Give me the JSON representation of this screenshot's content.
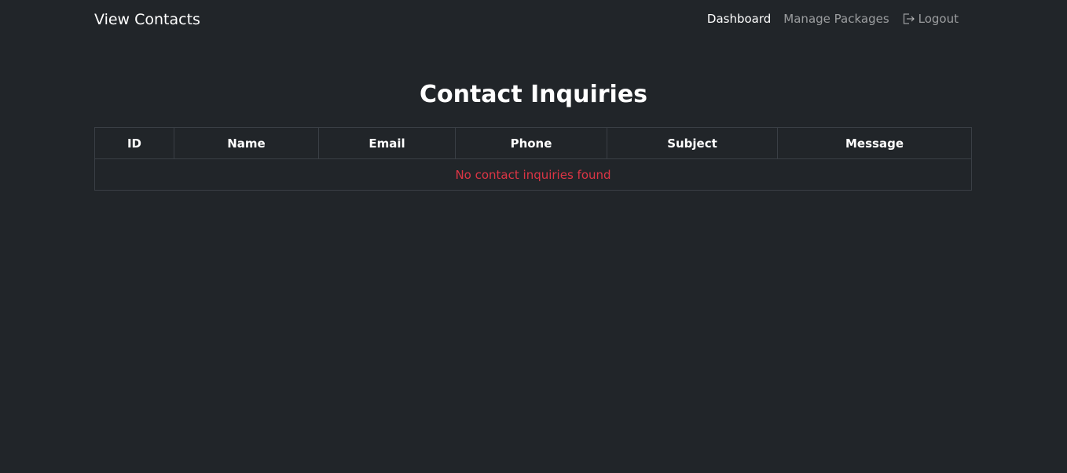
{
  "navbar": {
    "brand": "View Contacts",
    "links": [
      {
        "label": "Dashboard"
      },
      {
        "label": "Manage Packages"
      },
      {
        "label": "Logout",
        "icon": "logout-icon"
      }
    ]
  },
  "main": {
    "title": "Contact Inquiries",
    "table": {
      "columns": [
        "ID",
        "Name",
        "Email",
        "Phone",
        "Subject",
        "Message"
      ],
      "empty_message": "No contact inquiries found"
    }
  },
  "colors": {
    "background": "#212529",
    "empty_message": "#dc3545",
    "active_link": "#ffffff",
    "inactive_link": "rgba(255,255,255,0.55)"
  }
}
